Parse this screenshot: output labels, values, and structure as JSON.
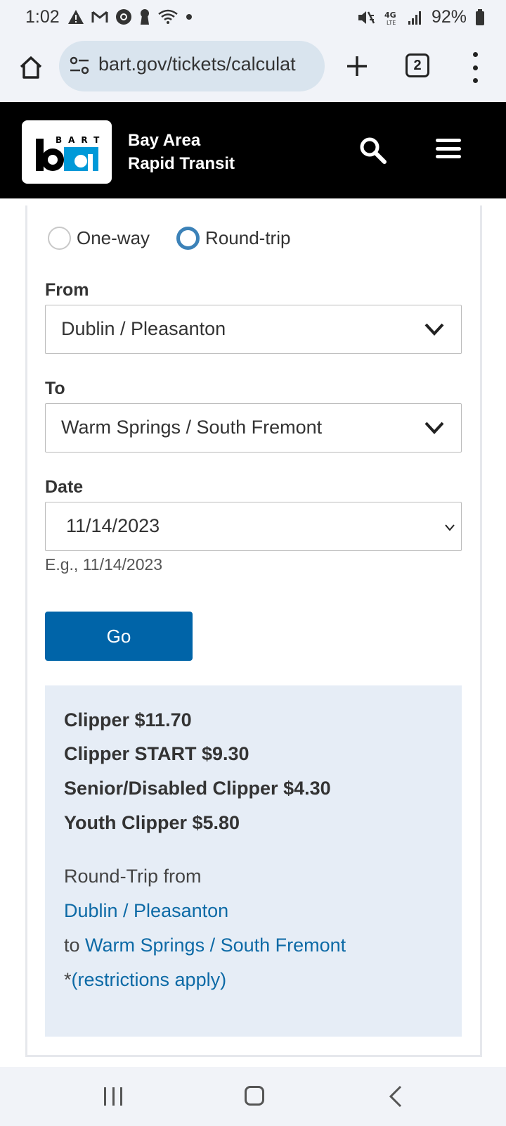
{
  "status_bar": {
    "time": "1:02",
    "battery": "92%",
    "icons": [
      "warning-icon",
      "gmail-icon",
      "chrome-icon",
      "keyhole-icon",
      "wifi-question-icon",
      "dot-icon",
      "mute-icon",
      "4g-lte-icon",
      "signal-icon",
      "battery-icon"
    ]
  },
  "browser": {
    "url": "bart.gov/tickets/calculat",
    "tab_count": "2"
  },
  "header": {
    "logo_letters": "BART",
    "site_name_line1": "Bay Area",
    "site_name_line2": "Rapid Transit"
  },
  "form": {
    "trip_options": [
      "One-way",
      "Round-trip"
    ],
    "selected_trip": "Round-trip",
    "from_label": "From",
    "from_value": "Dublin / Pleasanton",
    "to_label": "To",
    "to_value": "Warm Springs / South Fremont",
    "date_label": "Date",
    "date_value": "11/14/2023",
    "date_hint": "E.g., 11/14/2023",
    "go_label": "Go"
  },
  "fares": {
    "lines": [
      "Clipper $11.70",
      "Clipper START $9.30",
      "Senior/Disabled Clipper $4.30",
      "Youth Clipper $5.80"
    ],
    "trip_prefix": "Round-Trip from",
    "trip_from": "Dublin / Pleasanton",
    "trip_to_prefix": "to",
    "trip_to": "Warm Springs / South Fremont",
    "restrictions_prefix": "*",
    "restrictions_link": "(restrictions apply)"
  },
  "colors": {
    "accent": "#0064a8",
    "link": "#0d6aa6",
    "fare_bg": "#e6edf6",
    "header_bg": "#000000"
  }
}
